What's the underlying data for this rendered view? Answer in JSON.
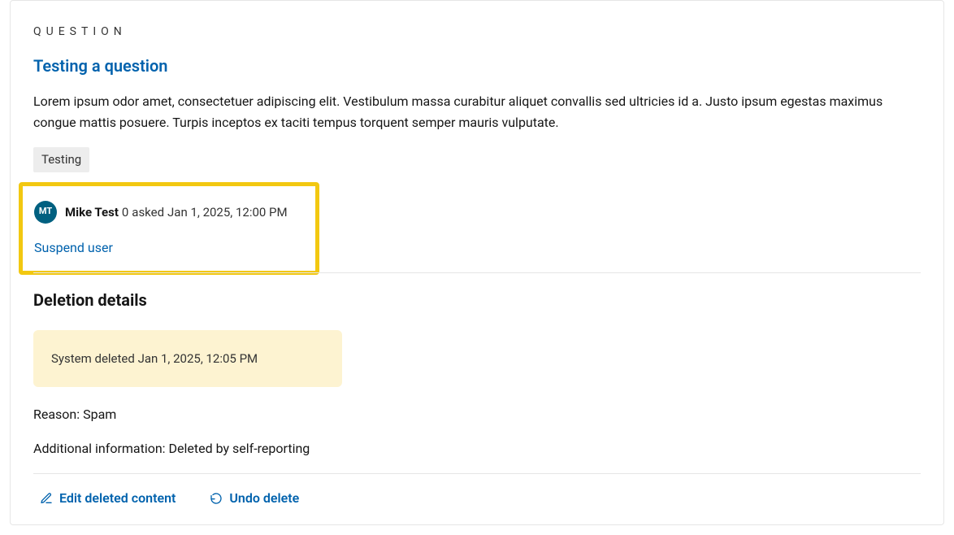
{
  "question": {
    "label": "QUESTION",
    "title": "Testing a question",
    "body": "Lorem ipsum odor amet, consectetuer adipiscing elit. Vestibulum massa curabitur aliquet convallis sed ultricies id a. Justo ipsum egestas maximus congue mattis posuere. Turpis inceptos ex taciti tempus torquent semper mauris vulputate.",
    "tag": "Testing"
  },
  "author": {
    "initials": "MT",
    "name": "Mike Test",
    "reputation": "0",
    "action_verb": "asked",
    "timestamp": "Jan 1, 2025, 12:00 PM",
    "suspend_label": "Suspend user"
  },
  "deletion": {
    "heading": "Deletion details",
    "banner_prefix": "System deleted",
    "banner_time": "Jan 1, 2025, 12:05 PM",
    "reason_label": "Reason:",
    "reason_value": "Spam",
    "additional_label": "Additional information:",
    "additional_value": "Deleted by self-reporting"
  },
  "actions": {
    "edit": "Edit deleted content",
    "undo": "Undo delete"
  }
}
